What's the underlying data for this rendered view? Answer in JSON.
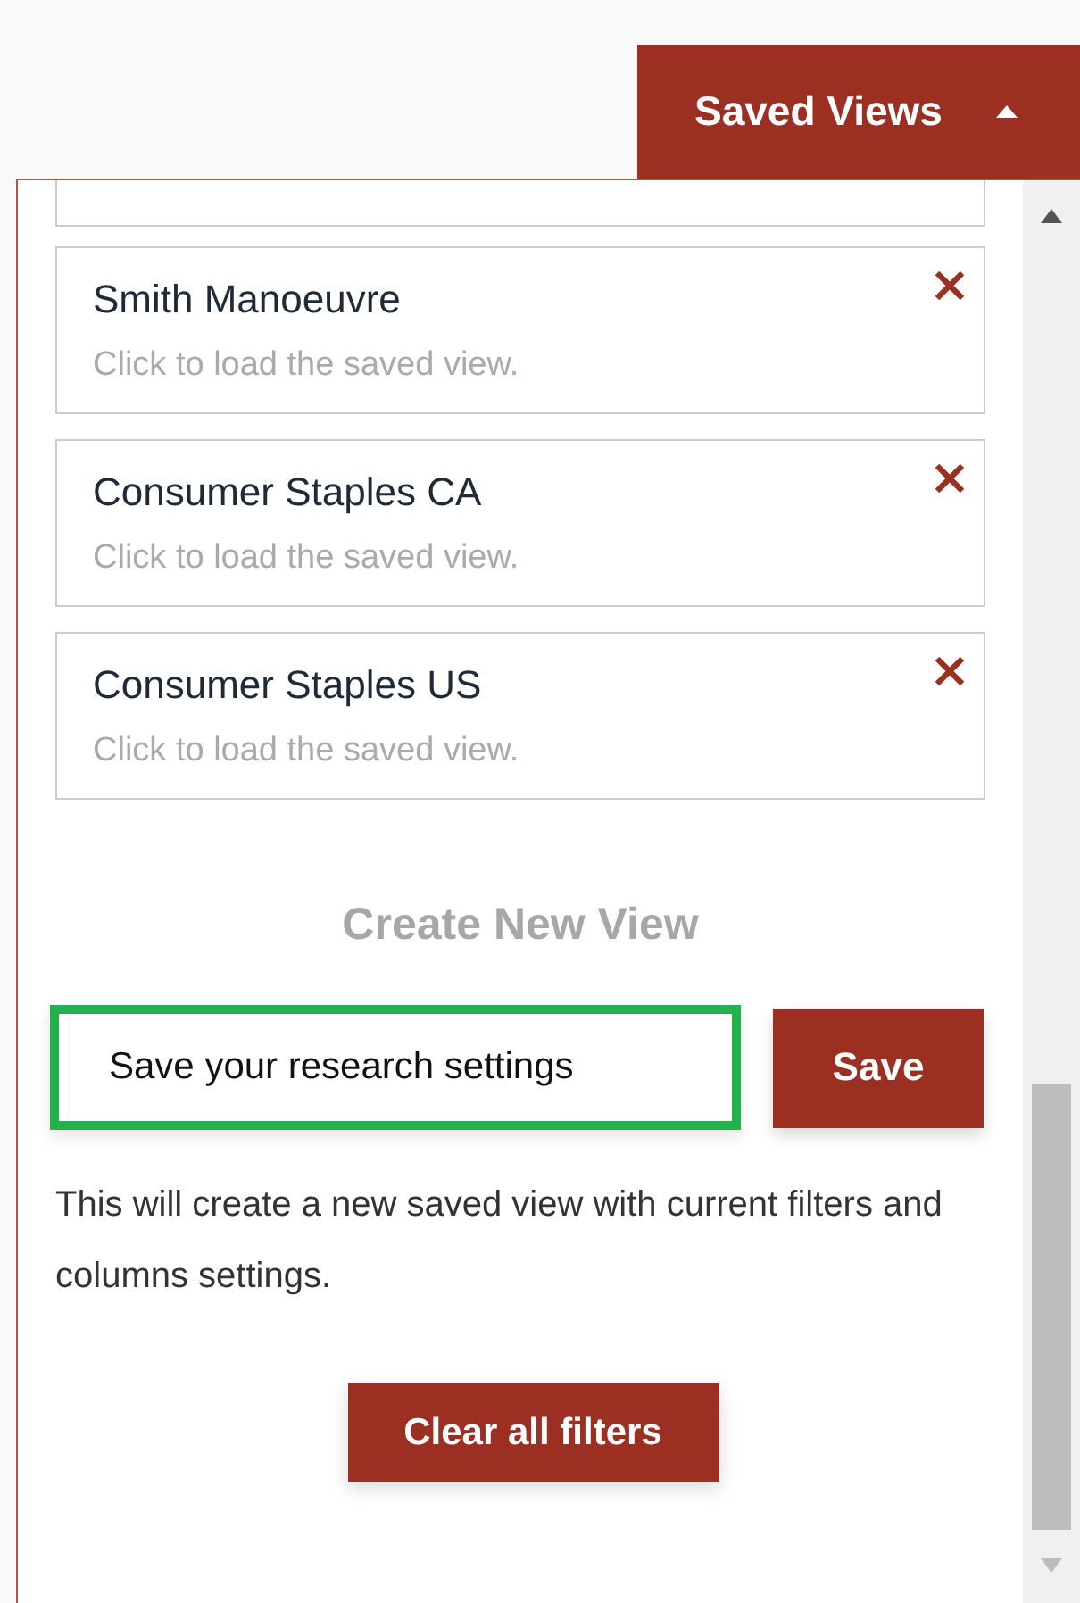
{
  "saved_views_button": {
    "label": "Saved Views",
    "expanded": true
  },
  "views": [
    {
      "name": "Smith Manoeuvre",
      "hint": "Click to load the saved view."
    },
    {
      "name": "Consumer Staples CA",
      "hint": "Click to load the saved view."
    },
    {
      "name": "Consumer Staples US",
      "hint": "Click to load the saved view."
    }
  ],
  "create": {
    "title": "Create New View",
    "input_value": "Save your research settings",
    "save_label": "Save",
    "note": "This will create a new saved view with current filters and columns settings."
  },
  "clear_button": "Clear all filters"
}
